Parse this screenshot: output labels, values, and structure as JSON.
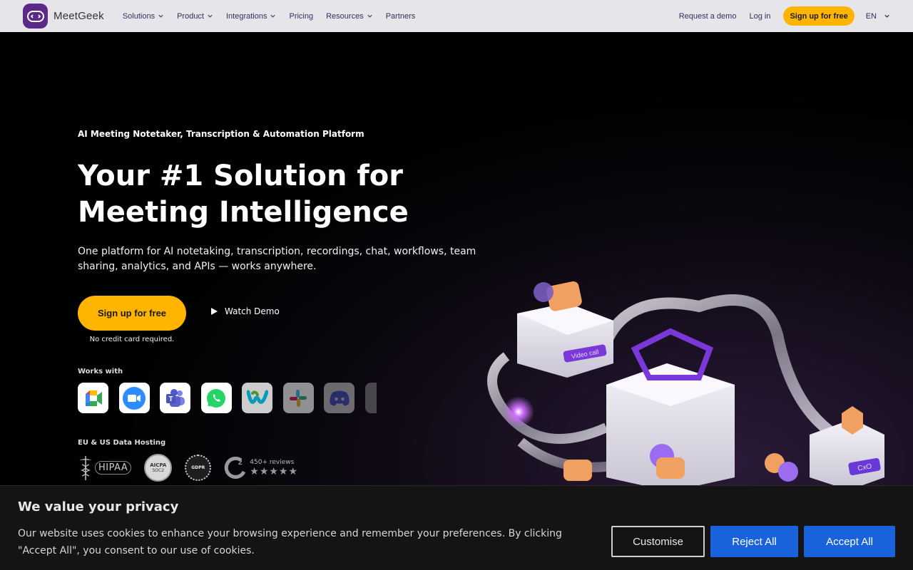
{
  "nav": {
    "brand": "MeetGeek",
    "links": [
      {
        "label": "Solutions",
        "has_menu": true
      },
      {
        "label": "Product",
        "has_menu": true
      },
      {
        "label": "Integrations",
        "has_menu": true
      },
      {
        "label": "Pricing",
        "has_menu": false
      },
      {
        "label": "Resources",
        "has_menu": true
      },
      {
        "label": "Partners",
        "has_menu": false
      }
    ],
    "request_demo": "Request a demo",
    "login": "Log in",
    "signup": "Sign up for free",
    "language": "EN"
  },
  "hero": {
    "eyebrow": "AI Meeting Notetaker, Transcription & Automation Platform",
    "headline_line1": "Your #1 Solution for",
    "headline_line2": "Meeting Intelligence",
    "subtext": "One platform for AI notetaking, transcription, recordings, chat, workflows, team sharing, analytics, and APIs — works anywhere.",
    "cta_primary": "Sign up for free",
    "cta_secondary": "Watch Demo",
    "cta_note": "No credit card required.",
    "works_with_label": "Works with",
    "apps": [
      "google-meet-icon",
      "zoom-icon",
      "microsoft-teams-icon",
      "whatsapp-icon",
      "webex-icon",
      "slack-icon",
      "discord-icon"
    ],
    "hosting_label": "EU & US Data Hosting",
    "badges": {
      "hipaa": "HIPAA",
      "aicpa_top": "AICPA",
      "aicpa_bottom": "SOC2",
      "gdpr": "GDPR",
      "g2_reviews": "450+ reviews",
      "g2_stars": "★★★★★"
    },
    "illustration_labels": {
      "video_call": "Video call",
      "crm": "CxO"
    }
  },
  "cookie": {
    "title": "We value your privacy",
    "text": "Our website uses cookies to enhance your browsing experience and remember your preferences. By clicking \"Accept All\", you consent to our use of cookies.",
    "customise": "Customise",
    "reject": "Reject All",
    "accept": "Accept All"
  },
  "colors": {
    "accent_yellow": "#ffb400",
    "brand_purple": "#5b2a86",
    "cookie_blue": "#1863dc",
    "nav_bg": "#e6e6ea"
  }
}
